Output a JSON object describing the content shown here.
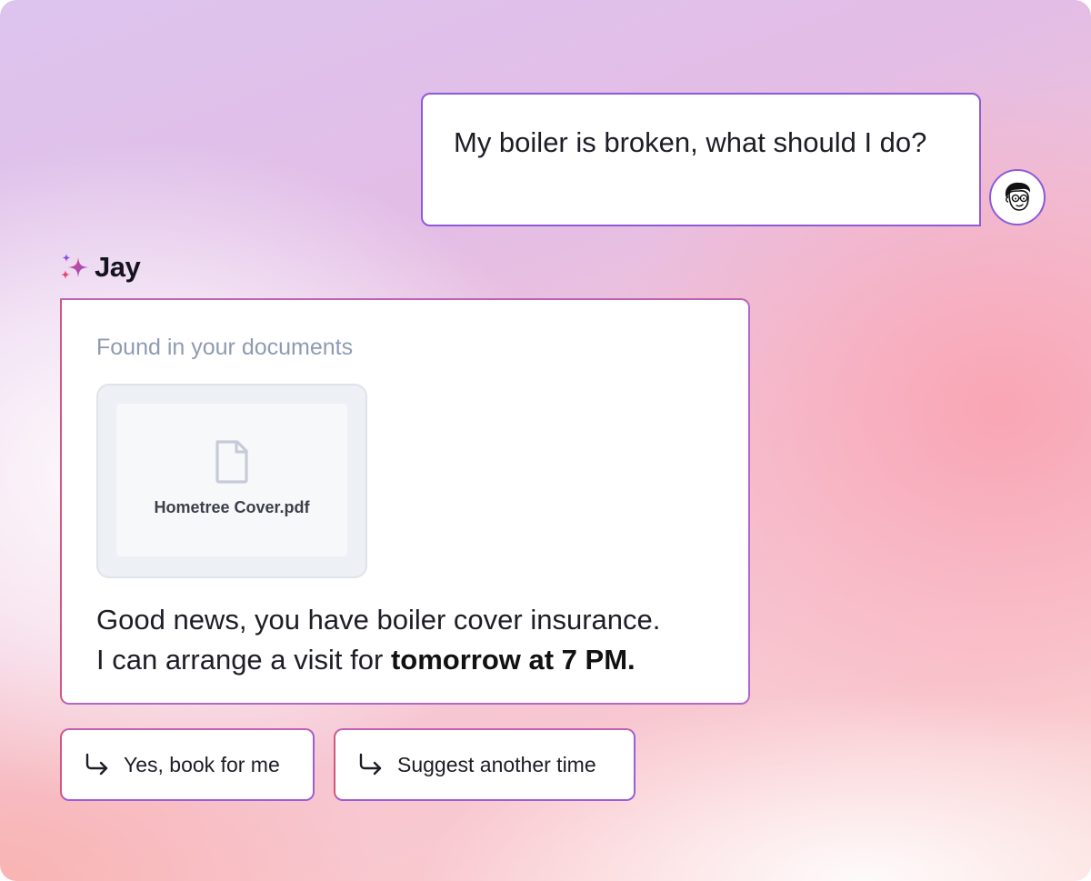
{
  "user_message": {
    "text": "My boiler is broken, what should I do?"
  },
  "assistant": {
    "name": "Jay",
    "sparkle_icon": "sparkles-icon",
    "found_label": "Found in your documents",
    "document": {
      "file_name": "Hometree Cover.pdf",
      "icon": "file-icon"
    },
    "reply_line1": "Good news, you have boiler cover insurance.",
    "reply_line2_prefix": "I can arrange a visit for ",
    "reply_line2_bold": "tomorrow at 7 PM."
  },
  "suggestions": [
    {
      "label": "Yes, book for me",
      "icon": "arrow-return-icon"
    },
    {
      "label": "Suggest another time",
      "icon": "arrow-return-icon"
    }
  ],
  "colors": {
    "accent_purple": "#8e5ad8",
    "accent_pink": "#d3567f",
    "muted_label": "#8f9bb3"
  }
}
